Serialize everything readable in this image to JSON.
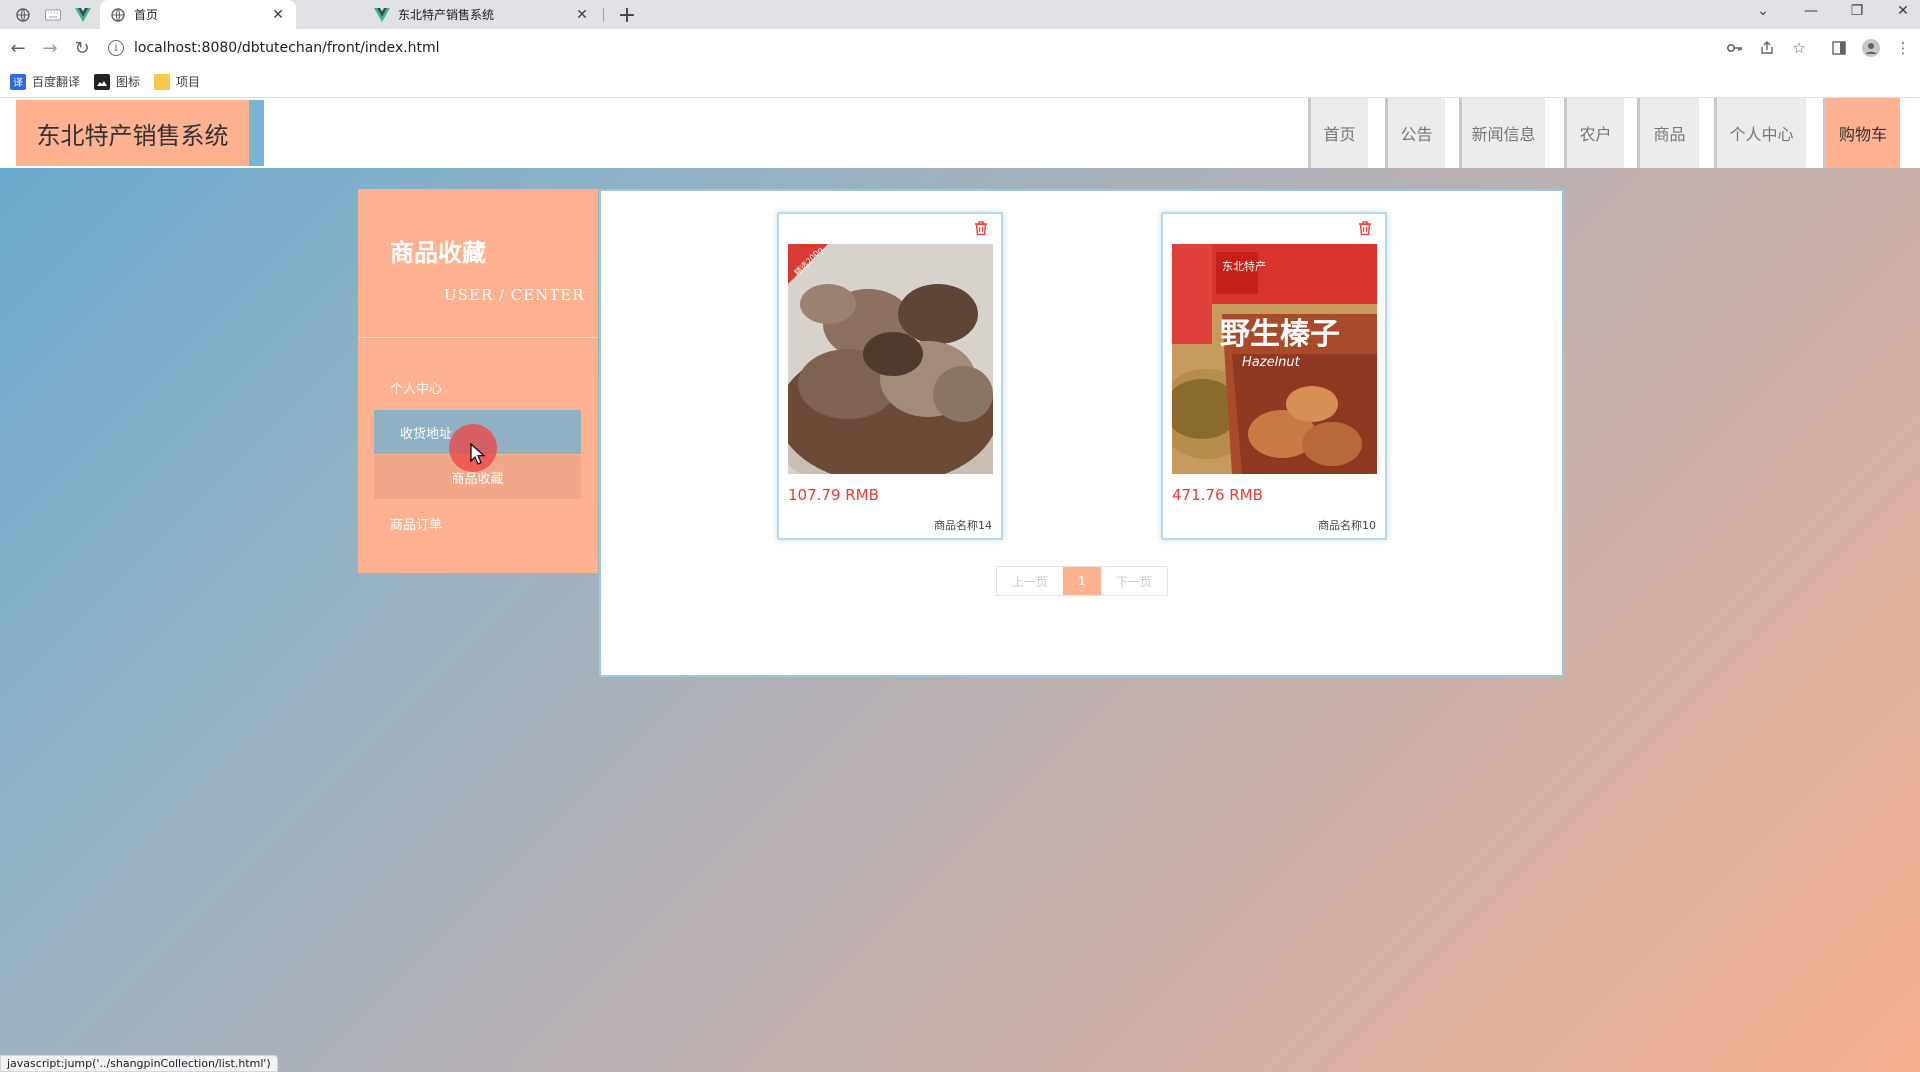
{
  "browser": {
    "tabs": [
      {
        "title": "首页",
        "icon": "globe-icon",
        "active": true
      },
      {
        "title": "东北特产销售系统",
        "icon": "vue-icon",
        "active": false
      }
    ],
    "url": "localhost:8080/dbtutechan/front/index.html",
    "bookmarks": [
      {
        "label": "百度翻译",
        "icon": "translate-icon",
        "color": "#2d6ae3"
      },
      {
        "label": "图标",
        "icon": "image-icon",
        "color": "#222222"
      },
      {
        "label": "项目",
        "icon": "folder-icon",
        "color": "#f7c948"
      }
    ],
    "status_url": "javascript:jump('../shangpinCollection/list.html')"
  },
  "site": {
    "logo": "东北特产销售系统",
    "nav": [
      "首页",
      "公告",
      "新闻信息",
      "农户",
      "商品",
      "个人中心",
      "购物车"
    ],
    "active_nav": "购物车"
  },
  "sidebar": {
    "title": "商品收藏",
    "subtitle": "USER / CENTER",
    "items": [
      "个人中心",
      "收货地址",
      "商品收藏",
      "商品订单"
    ]
  },
  "products": [
    {
      "price": "107.79 RMB",
      "name": "商品名称14",
      "image": "dried-mushroom-photo",
      "badge_text": "精选200g"
    },
    {
      "price": "471.76 RMB",
      "name": "商品名称10",
      "image": "hazelnut-package-photo",
      "tag": "东北特产",
      "title_text": "野生榛子",
      "brand_text": "Hazelnut"
    }
  ],
  "pager": {
    "prev": "上一页",
    "current": "1",
    "next": "下一页"
  },
  "colors": {
    "accent": "#ffb190",
    "price": "#e6403c",
    "hover_blue": "#8fb1c3"
  }
}
